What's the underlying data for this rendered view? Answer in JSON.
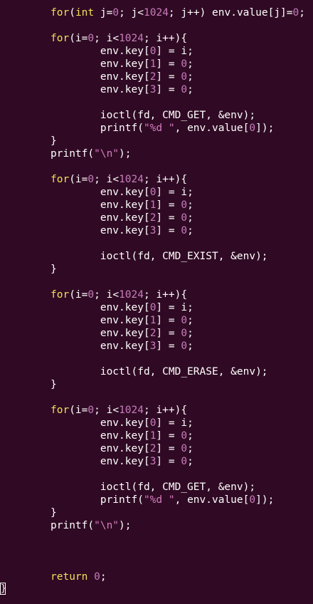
{
  "colors": {
    "background": "#300a24",
    "text": "#ffffff",
    "keyword": "#f2e15a",
    "number": "#c77dbb",
    "string": "#d67bbf"
  },
  "code_lines": [
    [
      {
        "t": "for",
        "c": "kw"
      },
      {
        "t": "(",
        "c": "plain"
      },
      {
        "t": "int",
        "c": "kw"
      },
      {
        "t": " j=",
        "c": "plain"
      },
      {
        "t": "0",
        "c": "num"
      },
      {
        "t": "; j<",
        "c": "plain"
      },
      {
        "t": "1024",
        "c": "num"
      },
      {
        "t": "; j++) env.value[j]=",
        "c": "plain"
      },
      {
        "t": "0",
        "c": "num"
      },
      {
        "t": ";",
        "c": "plain"
      }
    ],
    [],
    [
      {
        "t": "for",
        "c": "kw"
      },
      {
        "t": "(i=",
        "c": "plain"
      },
      {
        "t": "0",
        "c": "num"
      },
      {
        "t": "; i<",
        "c": "plain"
      },
      {
        "t": "1024",
        "c": "num"
      },
      {
        "t": "; i++){",
        "c": "plain"
      }
    ],
    [
      {
        "t": "        env.key[",
        "c": "plain"
      },
      {
        "t": "0",
        "c": "num"
      },
      {
        "t": "] = i;",
        "c": "plain"
      }
    ],
    [
      {
        "t": "        env.key[",
        "c": "plain"
      },
      {
        "t": "1",
        "c": "num"
      },
      {
        "t": "] = ",
        "c": "plain"
      },
      {
        "t": "0",
        "c": "num"
      },
      {
        "t": ";",
        "c": "plain"
      }
    ],
    [
      {
        "t": "        env.key[",
        "c": "plain"
      },
      {
        "t": "2",
        "c": "num"
      },
      {
        "t": "] = ",
        "c": "plain"
      },
      {
        "t": "0",
        "c": "num"
      },
      {
        "t": ";",
        "c": "plain"
      }
    ],
    [
      {
        "t": "        env.key[",
        "c": "plain"
      },
      {
        "t": "3",
        "c": "num"
      },
      {
        "t": "] = ",
        "c": "plain"
      },
      {
        "t": "0",
        "c": "num"
      },
      {
        "t": ";",
        "c": "plain"
      }
    ],
    [],
    [
      {
        "t": "        ioctl(fd, CMD_GET, &env);",
        "c": "plain"
      }
    ],
    [
      {
        "t": "        printf(",
        "c": "plain"
      },
      {
        "t": "\"%d \"",
        "c": "str"
      },
      {
        "t": ", env.value[",
        "c": "plain"
      },
      {
        "t": "0",
        "c": "num"
      },
      {
        "t": "]);",
        "c": "plain"
      }
    ],
    [
      {
        "t": "}",
        "c": "plain"
      }
    ],
    [
      {
        "t": "printf(",
        "c": "plain"
      },
      {
        "t": "\"\\n\"",
        "c": "str"
      },
      {
        "t": ");",
        "c": "plain"
      }
    ],
    [],
    [
      {
        "t": "for",
        "c": "kw"
      },
      {
        "t": "(i=",
        "c": "plain"
      },
      {
        "t": "0",
        "c": "num"
      },
      {
        "t": "; i<",
        "c": "plain"
      },
      {
        "t": "1024",
        "c": "num"
      },
      {
        "t": "; i++){",
        "c": "plain"
      }
    ],
    [
      {
        "t": "        env.key[",
        "c": "plain"
      },
      {
        "t": "0",
        "c": "num"
      },
      {
        "t": "] = i;",
        "c": "plain"
      }
    ],
    [
      {
        "t": "        env.key[",
        "c": "plain"
      },
      {
        "t": "1",
        "c": "num"
      },
      {
        "t": "] = ",
        "c": "plain"
      },
      {
        "t": "0",
        "c": "num"
      },
      {
        "t": ";",
        "c": "plain"
      }
    ],
    [
      {
        "t": "        env.key[",
        "c": "plain"
      },
      {
        "t": "2",
        "c": "num"
      },
      {
        "t": "] = ",
        "c": "plain"
      },
      {
        "t": "0",
        "c": "num"
      },
      {
        "t": ";",
        "c": "plain"
      }
    ],
    [
      {
        "t": "        env.key[",
        "c": "plain"
      },
      {
        "t": "3",
        "c": "num"
      },
      {
        "t": "] = ",
        "c": "plain"
      },
      {
        "t": "0",
        "c": "num"
      },
      {
        "t": ";",
        "c": "plain"
      }
    ],
    [],
    [
      {
        "t": "        ioctl(fd, CMD_EXIST, &env);",
        "c": "plain"
      }
    ],
    [
      {
        "t": "}",
        "c": "plain"
      }
    ],
    [],
    [
      {
        "t": "for",
        "c": "kw"
      },
      {
        "t": "(i=",
        "c": "plain"
      },
      {
        "t": "0",
        "c": "num"
      },
      {
        "t": "; i<",
        "c": "plain"
      },
      {
        "t": "1024",
        "c": "num"
      },
      {
        "t": "; i++){",
        "c": "plain"
      }
    ],
    [
      {
        "t": "        env.key[",
        "c": "plain"
      },
      {
        "t": "0",
        "c": "num"
      },
      {
        "t": "] = i;",
        "c": "plain"
      }
    ],
    [
      {
        "t": "        env.key[",
        "c": "plain"
      },
      {
        "t": "1",
        "c": "num"
      },
      {
        "t": "] = ",
        "c": "plain"
      },
      {
        "t": "0",
        "c": "num"
      },
      {
        "t": ";",
        "c": "plain"
      }
    ],
    [
      {
        "t": "        env.key[",
        "c": "plain"
      },
      {
        "t": "2",
        "c": "num"
      },
      {
        "t": "] = ",
        "c": "plain"
      },
      {
        "t": "0",
        "c": "num"
      },
      {
        "t": ";",
        "c": "plain"
      }
    ],
    [
      {
        "t": "        env.key[",
        "c": "plain"
      },
      {
        "t": "3",
        "c": "num"
      },
      {
        "t": "] = ",
        "c": "plain"
      },
      {
        "t": "0",
        "c": "num"
      },
      {
        "t": ";",
        "c": "plain"
      }
    ],
    [],
    [
      {
        "t": "        ioctl(fd, CMD_ERASE, &env);",
        "c": "plain"
      }
    ],
    [
      {
        "t": "}",
        "c": "plain"
      }
    ],
    [],
    [
      {
        "t": "for",
        "c": "kw"
      },
      {
        "t": "(i=",
        "c": "plain"
      },
      {
        "t": "0",
        "c": "num"
      },
      {
        "t": "; i<",
        "c": "plain"
      },
      {
        "t": "1024",
        "c": "num"
      },
      {
        "t": "; i++){",
        "c": "plain"
      }
    ],
    [
      {
        "t": "        env.key[",
        "c": "plain"
      },
      {
        "t": "0",
        "c": "num"
      },
      {
        "t": "] = i;",
        "c": "plain"
      }
    ],
    [
      {
        "t": "        env.key[",
        "c": "plain"
      },
      {
        "t": "1",
        "c": "num"
      },
      {
        "t": "] = ",
        "c": "plain"
      },
      {
        "t": "0",
        "c": "num"
      },
      {
        "t": ";",
        "c": "plain"
      }
    ],
    [
      {
        "t": "        env.key[",
        "c": "plain"
      },
      {
        "t": "2",
        "c": "num"
      },
      {
        "t": "] = ",
        "c": "plain"
      },
      {
        "t": "0",
        "c": "num"
      },
      {
        "t": ";",
        "c": "plain"
      }
    ],
    [
      {
        "t": "        env.key[",
        "c": "plain"
      },
      {
        "t": "3",
        "c": "num"
      },
      {
        "t": "] = ",
        "c": "plain"
      },
      {
        "t": "0",
        "c": "num"
      },
      {
        "t": ";",
        "c": "plain"
      }
    ],
    [],
    [
      {
        "t": "        ioctl(fd, CMD_GET, &env);",
        "c": "plain"
      }
    ],
    [
      {
        "t": "        printf(",
        "c": "plain"
      },
      {
        "t": "\"%d \"",
        "c": "str"
      },
      {
        "t": ", env.value[",
        "c": "plain"
      },
      {
        "t": "0",
        "c": "num"
      },
      {
        "t": "]);",
        "c": "plain"
      }
    ],
    [
      {
        "t": "}",
        "c": "plain"
      }
    ],
    [
      {
        "t": "printf(",
        "c": "plain"
      },
      {
        "t": "\"\\n\"",
        "c": "str"
      },
      {
        "t": ");",
        "c": "plain"
      }
    ],
    [],
    [],
    [],
    [
      {
        "t": "return",
        "c": "kw"
      },
      {
        "t": " ",
        "c": "plain"
      },
      {
        "t": "0",
        "c": "num"
      },
      {
        "t": ";",
        "c": "plain"
      }
    ]
  ],
  "closing_brace": "}"
}
